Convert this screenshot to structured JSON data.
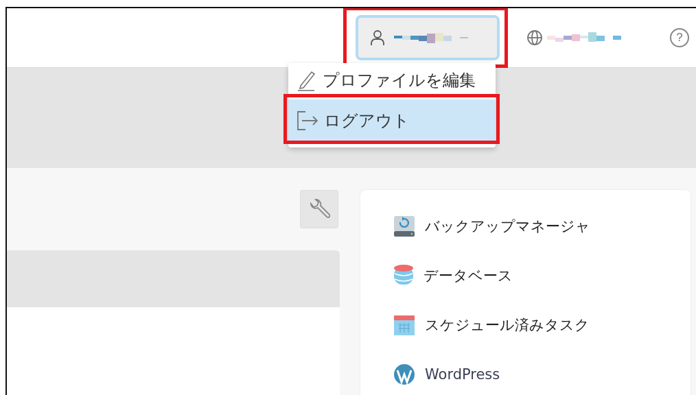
{
  "header": {
    "user_menu": {
      "expanded": true,
      "highlighted": true
    },
    "help": {
      "label": "?"
    }
  },
  "user_dropdown": {
    "items": [
      {
        "kind": "edit",
        "label": "プロファイルを編集",
        "selected": false,
        "highlighted": false
      },
      {
        "kind": "logout",
        "label": "ログアウト",
        "selected": true,
        "highlighted": true
      }
    ]
  },
  "tools": [
    {
      "kind": "backup",
      "label": "バックアップマネージャ"
    },
    {
      "kind": "database",
      "label": "データベース"
    },
    {
      "kind": "calendar",
      "label": "スケジュール済みタスク"
    },
    {
      "kind": "wordpress",
      "label": "WordPress"
    }
  ]
}
